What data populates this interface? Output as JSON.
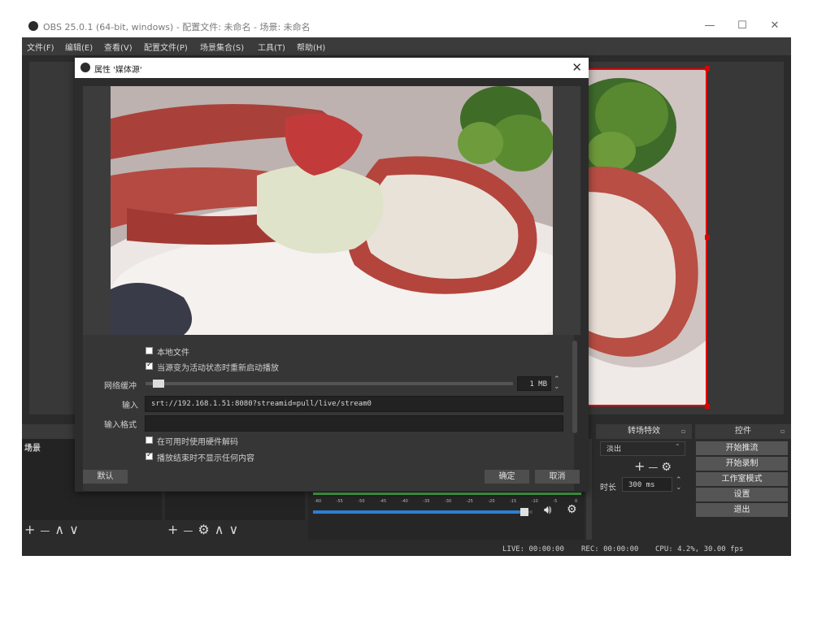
{
  "window": {
    "title": "OBS 25.0.1 (64-bit, windows) - 配置文件: 未命名 - 场景: 未命名",
    "minimize": "—",
    "maximize": "☐",
    "close": "✕"
  },
  "menu": [
    "文件(F)",
    "编辑(E)",
    "查看(V)",
    "配置文件(P)",
    "场景集合(S)",
    "工具(T)",
    "帮助(H)"
  ],
  "docks": {
    "scenes_title": "场景",
    "transitions_title": "转场特效",
    "transition_select": "淡出",
    "duration_label": "时长",
    "duration_value": "300 ms",
    "controls_title": "控件",
    "controls": [
      "开始推流",
      "开始录制",
      "工作室模式",
      "设置",
      "退出"
    ],
    "plus": "+",
    "minus": "—",
    "up": "∧",
    "down": "∨",
    "meter_ticks": [
      "-60",
      "-55",
      "-50",
      "-45",
      "-40",
      "-35",
      "-30",
      "-25",
      "-20",
      "-15",
      "-10",
      "-5",
      "0"
    ],
    "volume_level": 0.98
  },
  "status": {
    "live": "LIVE: 00:00:00",
    "rec": "REC: 00:00:00",
    "cpu": "CPU: 4.2%, 30.00 fps"
  },
  "dialog": {
    "title": "属性 '媒体源'",
    "close": "✕",
    "local_file_label": "本地文件",
    "local_file_checked": false,
    "restart_label": "当源变为活动状态时重新启动播放",
    "restart_checked": true,
    "buffer_label": "网络缓冲",
    "buffer_value": "1 MB",
    "buffer_level": 0.02,
    "input_label": "输入",
    "input_value": "srt://192.168.1.51:8080?streamid=pull/live/stream0",
    "input_format_label": "输入格式",
    "input_format_value": "",
    "hw_decode_label": "在可用时使用硬件解码",
    "hw_decode_checked": false,
    "hide_on_end_label": "播放结束时不显示任何内容",
    "hide_on_end_checked": true,
    "defaults_button": "默认",
    "ok_button": "确定",
    "cancel_button": "取消"
  },
  "colors": {
    "selection_border": "#e00000",
    "dark_bg": "#2b2b2b",
    "meter_green": "#4caf50",
    "volume_blue": "#2d7fd3"
  }
}
